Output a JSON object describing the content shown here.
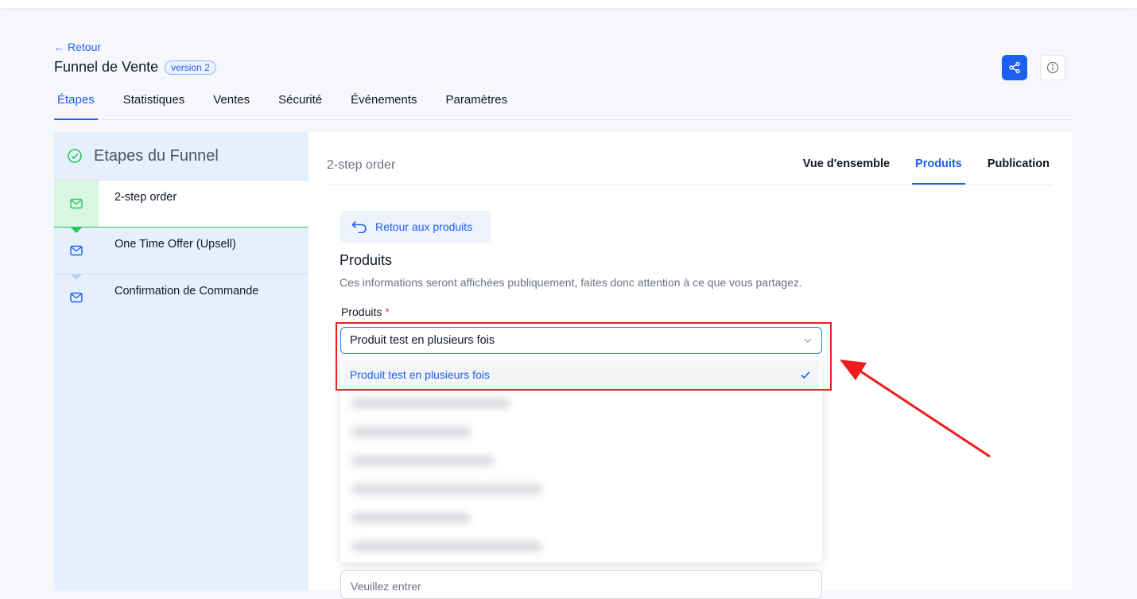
{
  "header": {
    "back_label": "Retour",
    "title": "Funnel de Vente",
    "version_badge": "version 2"
  },
  "tabs": [
    {
      "label": "Étapes",
      "active": true
    },
    {
      "label": "Statistiques"
    },
    {
      "label": "Ventes"
    },
    {
      "label": "Sécurité"
    },
    {
      "label": "Événements"
    },
    {
      "label": "Paramètres"
    }
  ],
  "sidebar": {
    "title": "Etapes du Funnel",
    "steps": [
      {
        "label": "2-step order",
        "active": true
      },
      {
        "label": "One Time Offer (Upsell)"
      },
      {
        "label": "Confirmation de Commande"
      }
    ]
  },
  "main": {
    "step_name": "2-step order",
    "subtabs": [
      {
        "label": "Vue d'ensemble"
      },
      {
        "label": "Produits",
        "active": true
      },
      {
        "label": "Publication"
      }
    ],
    "back_to_products": "Retour aux produits",
    "section_title": "Produits",
    "section_desc": "Ces informations seront affichées publiquement, faites donc attention à ce que vous partagez.",
    "field_label": "Produits",
    "required_mark": "*",
    "select_value": "Produit test en plusieurs fois",
    "dropdown_selected_option": "Produit test en plusieurs fois",
    "input_placeholder": "Veuillez entrer"
  },
  "colors": {
    "accent": "#1d5ff0",
    "success": "#22c55e",
    "annotation": "#ef1c1c",
    "sidebar_bg": "#e6f0fc"
  }
}
